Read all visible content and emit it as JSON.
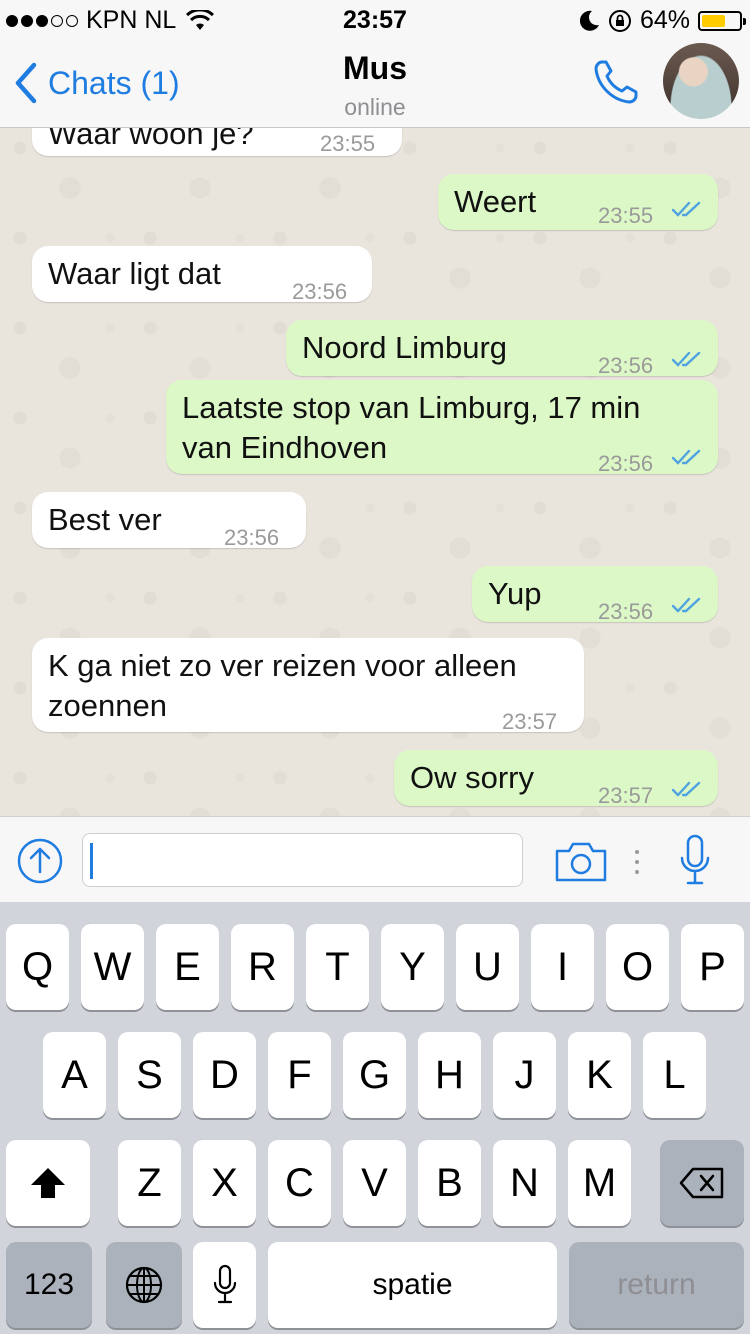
{
  "status_bar": {
    "carrier": "KPN NL",
    "time": "23:57",
    "battery_percent": "64%",
    "battery_level": 0.64,
    "signal_bars": 3
  },
  "nav": {
    "back_label": "Chats (1)",
    "contact_name": "Mus",
    "contact_status": "online"
  },
  "messages": [
    {
      "dir": "in",
      "text": "Waar woon je?",
      "time": "23:55"
    },
    {
      "dir": "out",
      "text": "Weert",
      "time": "23:55"
    },
    {
      "dir": "in",
      "text": "Waar ligt dat",
      "time": "23:56"
    },
    {
      "dir": "out",
      "text": "Noord Limburg",
      "time": "23:56"
    },
    {
      "dir": "out",
      "text": "Laatste stop van Limburg, 17 min",
      "text2": "van Eindhoven",
      "time": "23:56"
    },
    {
      "dir": "in",
      "text": "Best ver",
      "time": "23:56"
    },
    {
      "dir": "out",
      "text": "Yup",
      "time": "23:56"
    },
    {
      "dir": "in",
      "text": "K ga niet zo ver reizen voor alleen",
      "text2": "zoennen",
      "time": "23:57"
    },
    {
      "dir": "out",
      "text": "Ow sorry",
      "time": "23:57"
    }
  ],
  "input": {
    "value": "",
    "placeholder": ""
  },
  "keyboard": {
    "row1": [
      "Q",
      "W",
      "E",
      "R",
      "T",
      "Y",
      "U",
      "I",
      "O",
      "P"
    ],
    "row2": [
      "A",
      "S",
      "D",
      "F",
      "G",
      "H",
      "J",
      "K",
      "L"
    ],
    "row3": [
      "Z",
      "X",
      "C",
      "V",
      "B",
      "N",
      "M"
    ],
    "numbers_label": "123",
    "space_label": "spatie",
    "return_label": "return"
  },
  "colors": {
    "accent": "#1f7ce0",
    "outgoing_bubble": "#dcf8c6",
    "incoming_bubble": "#ffffff",
    "tick_read": "#4fa3e0"
  },
  "icons": [
    "back-chevron-icon",
    "phone-icon",
    "upload-icon",
    "camera-icon",
    "microphone-icon",
    "shift-icon",
    "backspace-icon",
    "globe-icon",
    "keyboard-mic-icon",
    "double-check-icon"
  ]
}
